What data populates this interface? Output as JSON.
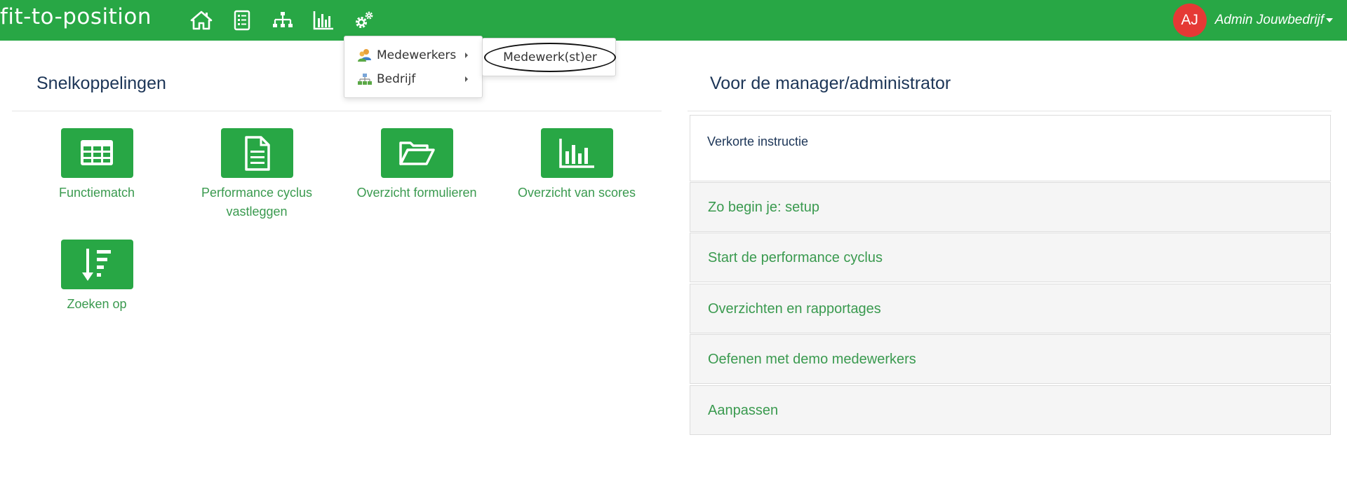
{
  "app": {
    "brand": "fit-to-position",
    "accent": "#28a745",
    "text_green": "#3a9a4f",
    "heading_color": "#1c3557"
  },
  "nav": {
    "icons": [
      "home-icon",
      "list-icon",
      "org-chart-icon",
      "bar-chart-icon",
      "gears-icon"
    ],
    "user": {
      "initials": "AJ",
      "name": "Admin Jouwbedrijf",
      "avatar_color": "#e53935"
    }
  },
  "dropdown": {
    "items": [
      {
        "label": "Medewerkers",
        "icon": "users-icon",
        "has_submenu": true
      },
      {
        "label": "Bedrijf",
        "icon": "company-icon",
        "has_submenu": true
      }
    ],
    "submenu": {
      "items": [
        {
          "label": "Medewerk(st)er"
        }
      ]
    }
  },
  "shortcuts": {
    "title": "Snelkoppelingen",
    "tiles": [
      {
        "label": "Functiematch",
        "icon": "table-icon"
      },
      {
        "label": "Performance cyclus vastleggen",
        "icon": "document-icon"
      },
      {
        "label": "Overzicht formulieren",
        "icon": "folder-open-icon"
      },
      {
        "label": "Overzicht van scores",
        "icon": "bar-chart-icon"
      },
      {
        "label": "Zoeken op",
        "icon": "sort-desc-icon"
      }
    ]
  },
  "manager": {
    "title": "Voor de manager/administrator",
    "intro": "Verkorte instructie",
    "accordion": [
      {
        "label": "Zo begin je: setup"
      },
      {
        "label": "Start de performance cyclus"
      },
      {
        "label": "Overzichten en rapportages"
      },
      {
        "label": "Oefenen met demo medewerkers"
      },
      {
        "label": "Aanpassen"
      }
    ]
  }
}
